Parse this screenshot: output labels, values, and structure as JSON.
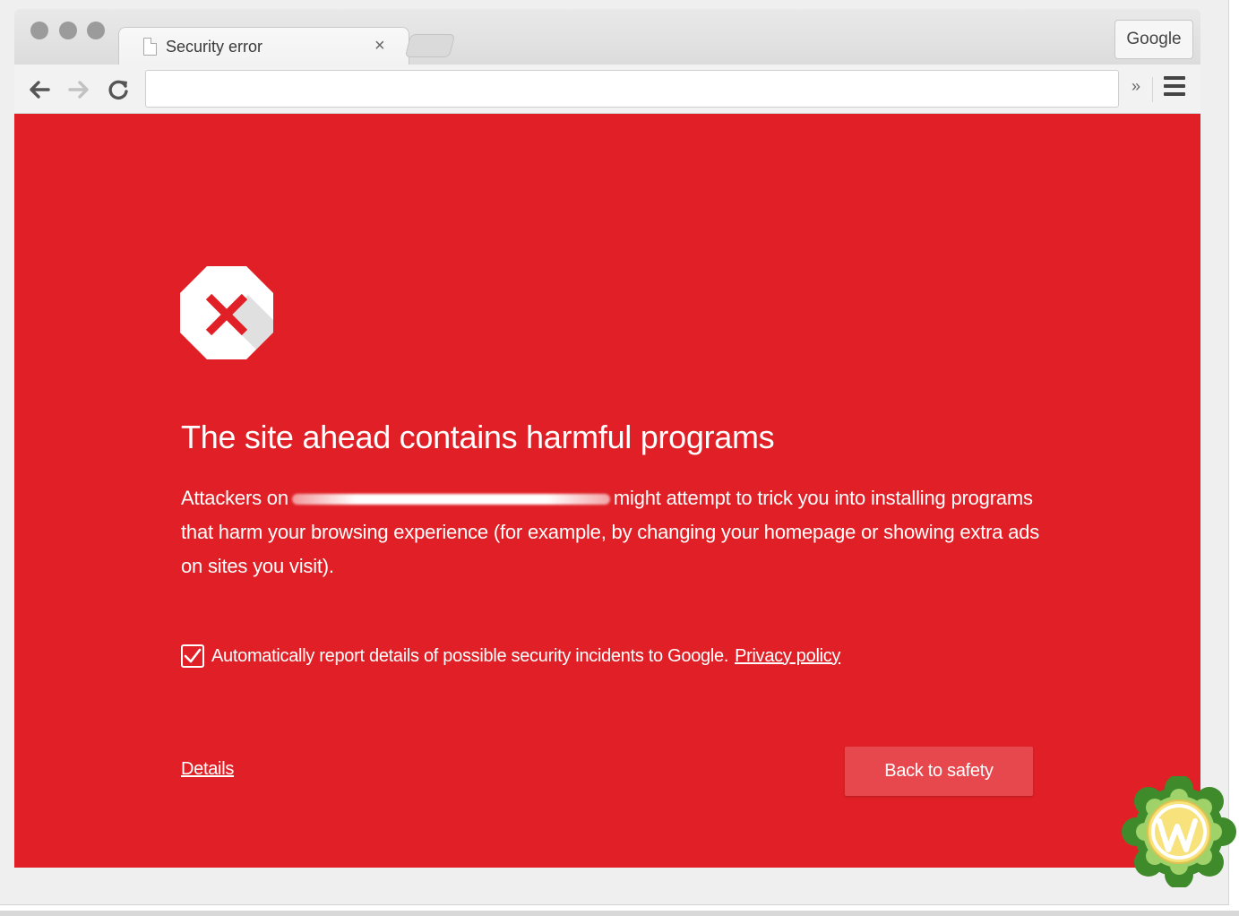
{
  "browser": {
    "tab_title": "Security error",
    "tab_close": "×",
    "profile_button": "Google",
    "address_value": "",
    "overflow_label": "»"
  },
  "page": {
    "headline": "The site ahead contains harmful programs",
    "body_before": "Attackers on",
    "body_after": "might attempt to trick you into installing programs that harm your browsing experience (for example, by changing your homepage or showing extra ads on sites you visit).",
    "report_checked": true,
    "report_text": "Automatically report details of possible security incidents to Google.",
    "privacy_link": "Privacy policy",
    "details_link": "Details",
    "back_button": "Back to safety"
  },
  "colors": {
    "danger_red": "#e02026",
    "button_red": "#e6484d",
    "chrome_gray": "#efefef"
  },
  "icons": {
    "error": "octagon-x-icon",
    "badge": "wordpress-logo-icon"
  }
}
